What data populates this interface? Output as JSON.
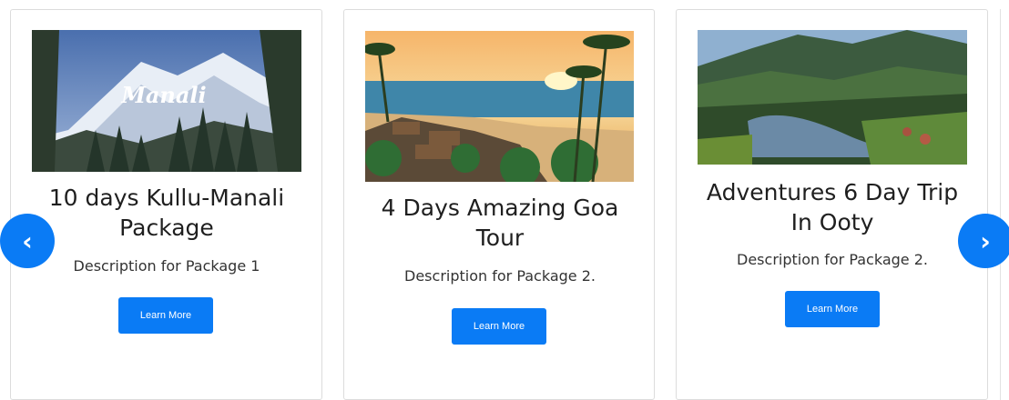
{
  "packages": [
    {
      "image_label": "Manali",
      "title": "10 days Kullu-Manali Package",
      "description": "Description for Package 1",
      "button_label": "Learn More"
    },
    {
      "title": "4 Days Amazing Goa Tour",
      "description": "Description for Package 2.",
      "button_label": "Learn More"
    },
    {
      "title": "Adventures 6 Day Trip In Ooty",
      "description": "Description for Package 2.",
      "button_label": "Learn More"
    }
  ],
  "carousel": {
    "prev_icon": "chevron-left-icon",
    "next_icon": "chevron-right-icon",
    "prev_glyph": "‹",
    "next_glyph": "›"
  },
  "colors": {
    "accent": "#0a7bf5",
    "title": "#1f1f1f",
    "text": "#333333"
  }
}
